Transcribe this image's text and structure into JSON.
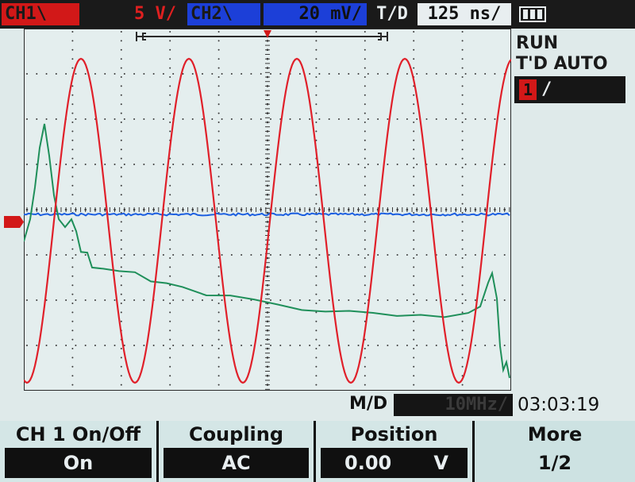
{
  "status_bar": {
    "ch1_label": "CH1\\",
    "ch1_scale": "5 V/",
    "ch2_label": "CH2\\",
    "ch2_scale": "20 mV/",
    "timebase_label": "T/D",
    "timebase_value": "125 ns/",
    "battery_icon": "battery-icon"
  },
  "side_panel": {
    "run_state": "RUN",
    "trigger_mode": "T'D AUTO",
    "trigger_source": "1",
    "trigger_edge": "/"
  },
  "info_row": {
    "md_label": "M/D",
    "bandwidth": "10MHz/",
    "clock": "03:03:19"
  },
  "softkeys": [
    {
      "title": "CH 1 On/Off",
      "value": "On"
    },
    {
      "title": "Coupling",
      "value": "AC"
    },
    {
      "title": "Position",
      "value": "0.00",
      "unit": "V"
    },
    {
      "title": "More",
      "value": "1/2"
    }
  ],
  "colors": {
    "ch1": "#d21818",
    "ch2": "#1c3fd8",
    "ch3": "#1f8f5a",
    "grid": "#2a2a2a",
    "background": "#dfeaea"
  }
}
